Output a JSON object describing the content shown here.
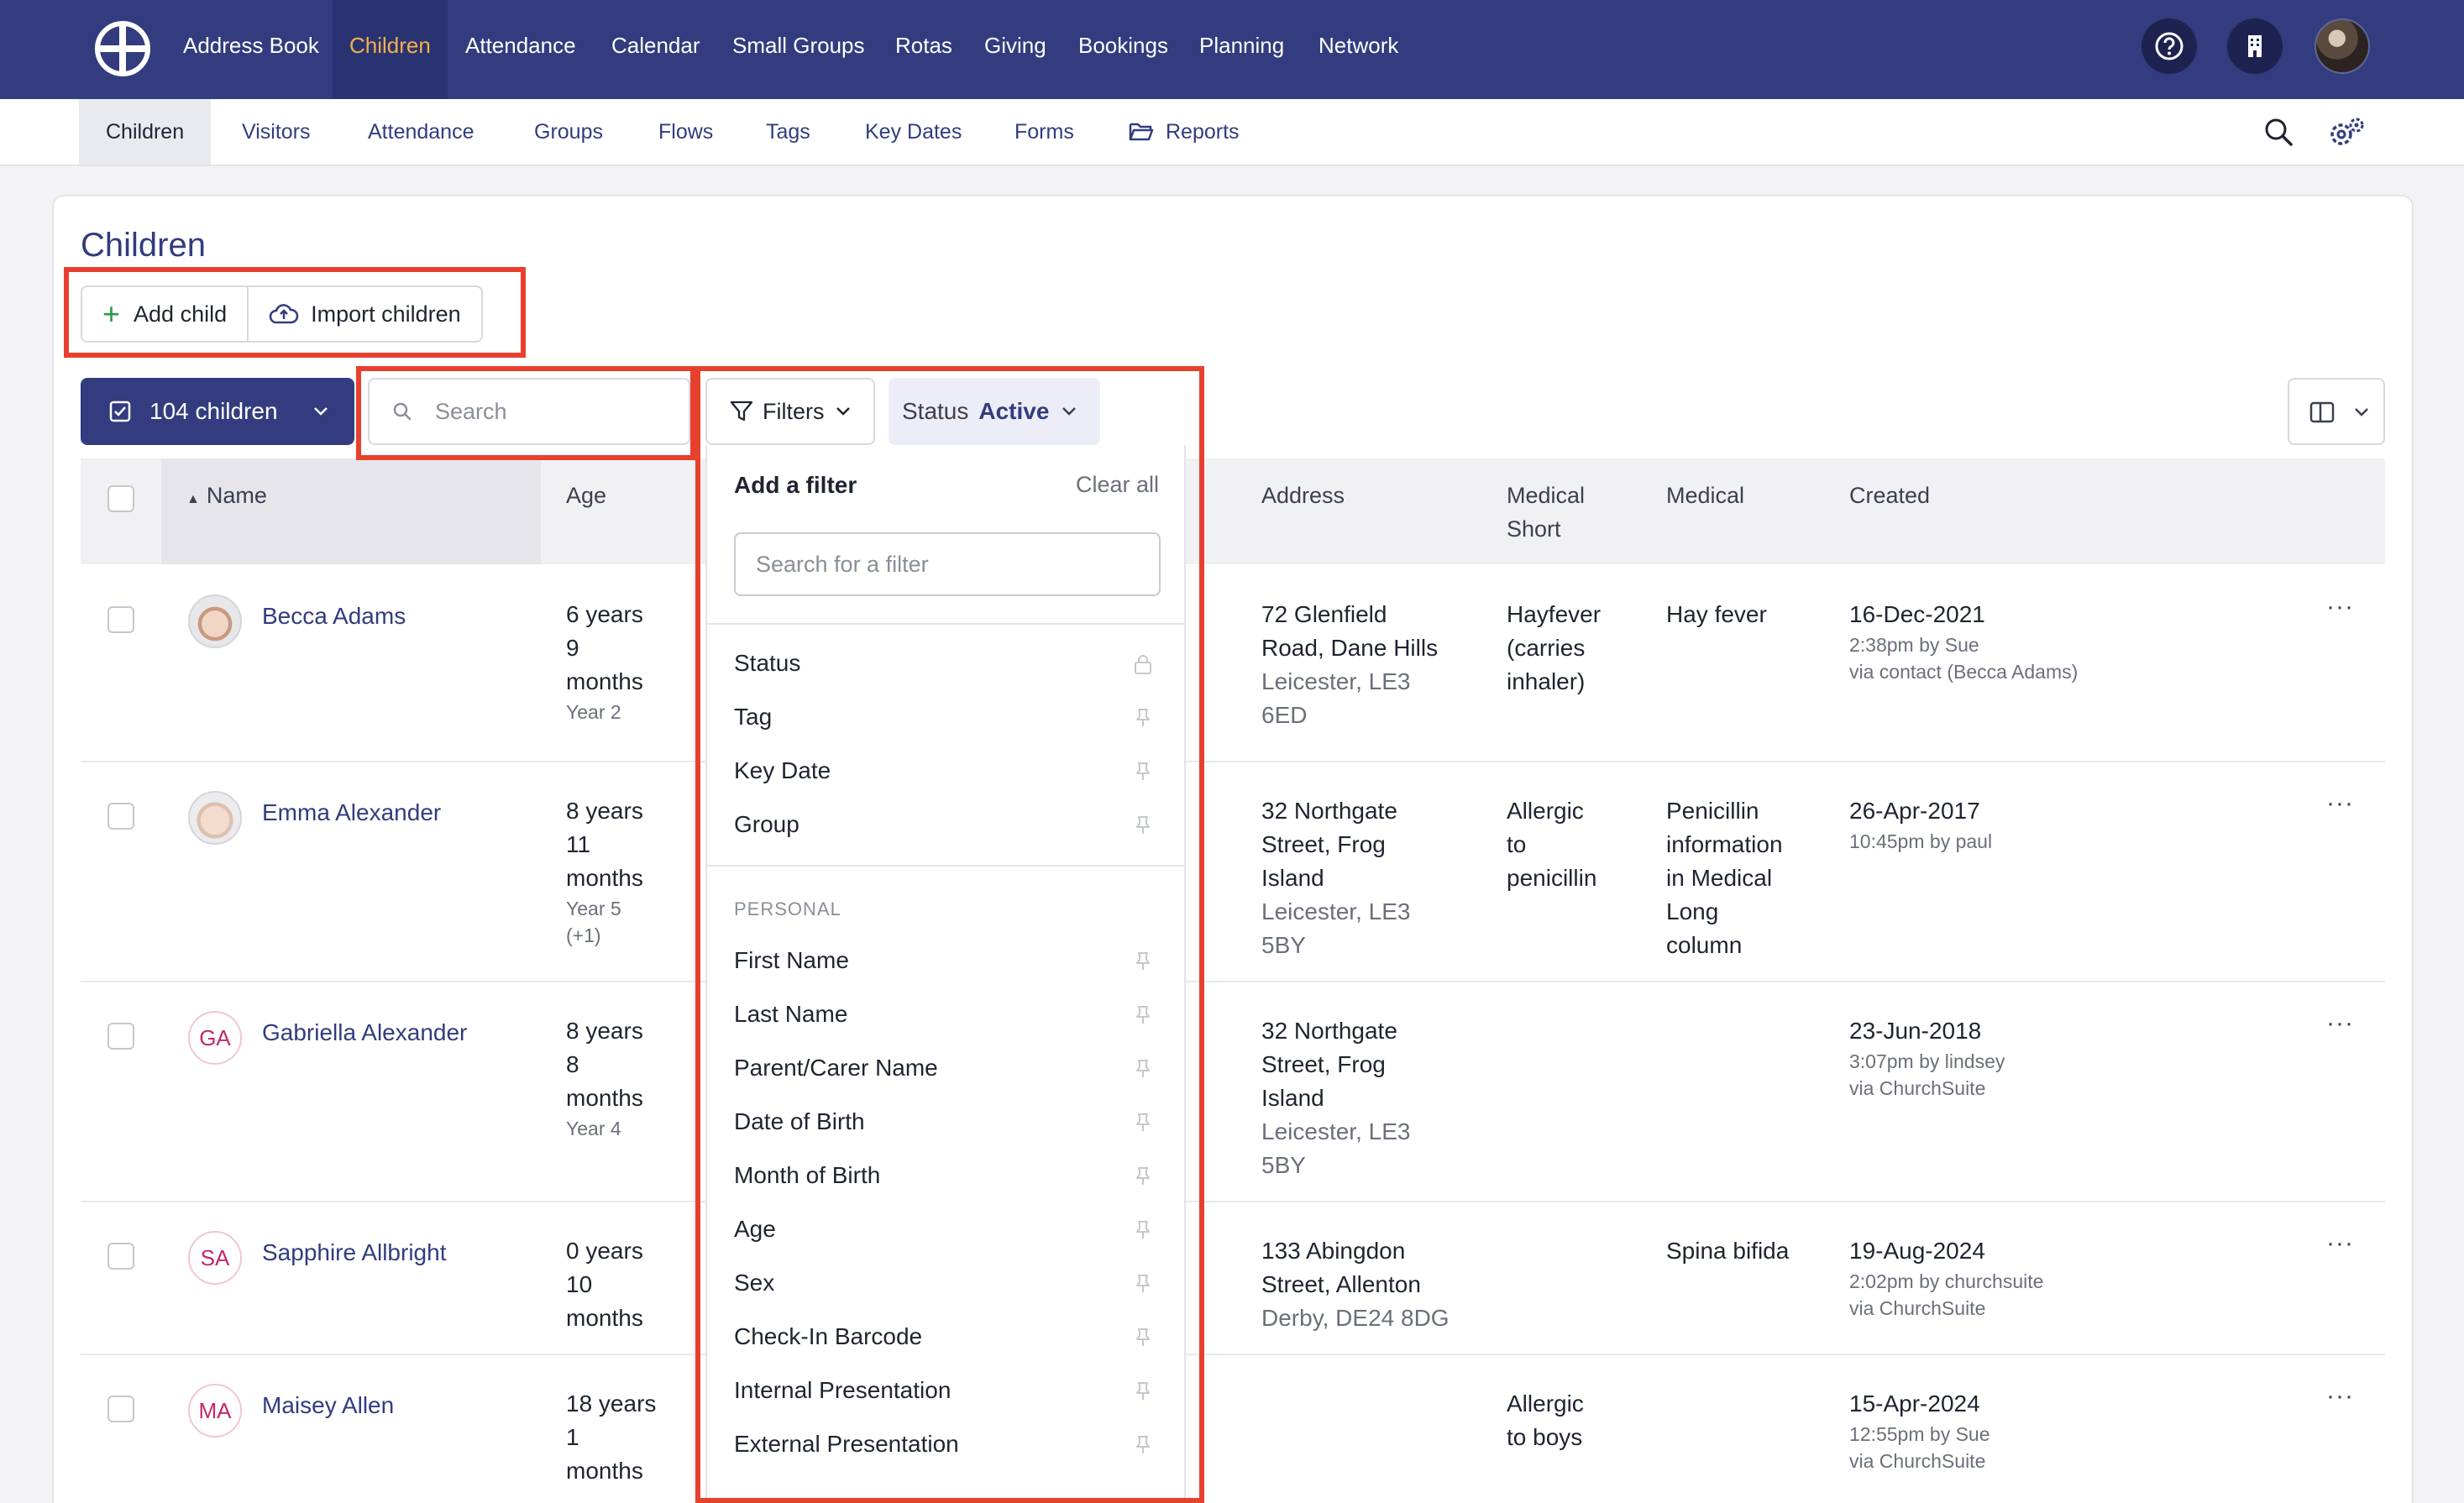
{
  "topnav": {
    "items": [
      "Address Book",
      "Children",
      "Attendance",
      "Calendar",
      "Small Groups",
      "Rotas",
      "Giving",
      "Bookings",
      "Planning",
      "Network"
    ],
    "active": "Children"
  },
  "subnav": {
    "items": [
      "Children",
      "Visitors",
      "Attendance",
      "Groups",
      "Flows",
      "Tags",
      "Key Dates",
      "Forms",
      "Reports"
    ]
  },
  "page": {
    "title": "Children",
    "add_child": "Add child",
    "import_children": "Import children",
    "count_label": "104 children",
    "search_placeholder": "Search",
    "filters_label": "Filters",
    "status_label": "Status",
    "status_value": "Active"
  },
  "table": {
    "columns": {
      "name": "Name",
      "age": "Age",
      "address": "Address",
      "medical_short_1": "Medical",
      "medical_short_2": "Short",
      "medical": "Medical",
      "created": "Created"
    },
    "rows": [
      {
        "name": "Becca Adams",
        "initials": "",
        "age": [
          "6 years",
          "9",
          "months"
        ],
        "age_sub": [
          "Year 2"
        ],
        "address": [
          "72 Glenfield",
          "Road, Dane Hills"
        ],
        "address_sub": [
          "Leicester, LE3",
          "6ED"
        ],
        "medical_short": [
          "Hayfever",
          "(carries",
          "inhaler)"
        ],
        "medical": [
          "Hay fever"
        ],
        "created": "16-Dec-2021",
        "created_sub": [
          "2:38pm by Sue",
          "via contact (Becca Adams)"
        ]
      },
      {
        "name": "Emma Alexander",
        "initials": "",
        "age": [
          "8 years",
          "11",
          "months"
        ],
        "age_sub": [
          "Year 5",
          "(+1)"
        ],
        "address": [
          "32 Northgate",
          "Street, Frog",
          "Island"
        ],
        "address_sub": [
          "Leicester, LE3",
          "5BY"
        ],
        "medical_short": [
          "Allergic",
          "to",
          "penicillin"
        ],
        "medical": [
          "Penicillin",
          "information",
          "in Medical",
          "Long",
          "column"
        ],
        "created": "26-Apr-2017",
        "created_sub": [
          "10:45pm by paul"
        ]
      },
      {
        "name": "Gabriella Alexander",
        "initials": "GA",
        "age": [
          "8 years",
          "8",
          "months"
        ],
        "age_sub": [
          "Year 4"
        ],
        "address": [
          "32 Northgate",
          "Street, Frog",
          "Island"
        ],
        "address_sub": [
          "Leicester, LE3",
          "5BY"
        ],
        "medical_short": [],
        "medical": [],
        "created": "23-Jun-2018",
        "created_sub": [
          "3:07pm by lindsey",
          "via ChurchSuite"
        ]
      },
      {
        "name": "Sapphire Allbright",
        "initials": "SA",
        "age": [
          "0 years",
          "10",
          "months"
        ],
        "age_sub": [],
        "address": [
          "133 Abingdon",
          "Street, Allenton"
        ],
        "address_sub": [
          "Derby, DE24 8DG"
        ],
        "medical_short": [],
        "medical": [
          "Spina bifida"
        ],
        "created": "19-Aug-2024",
        "created_sub": [
          "2:02pm by churchsuite",
          "via ChurchSuite"
        ]
      },
      {
        "name": "Maisey Allen",
        "initials": "MA",
        "age": [
          "18 years",
          "1",
          "months"
        ],
        "age_sub": [],
        "address": [],
        "address_sub": [],
        "medical_short": [
          "Allergic",
          "to boys"
        ],
        "medical": [],
        "created": "15-Apr-2024",
        "created_sub": [
          "12:55pm by Sue",
          "via ChurchSuite"
        ]
      }
    ]
  },
  "filter_menu": {
    "title": "Add a filter",
    "clear_all": "Clear all",
    "search_placeholder": "Search for a filter",
    "pinned": [
      "Status",
      "Tag",
      "Key Date",
      "Group"
    ],
    "section": "PERSONAL",
    "personal": [
      "First Name",
      "Last Name",
      "Parent/Carer Name",
      "Date of Birth",
      "Month of Birth",
      "Age",
      "Sex",
      "Check-In Barcode",
      "Internal Presentation",
      "External Presentation"
    ]
  },
  "colors": {
    "brand": "#323c7e",
    "active_nav": "#f3b04a",
    "highlight": "#e8402e"
  }
}
